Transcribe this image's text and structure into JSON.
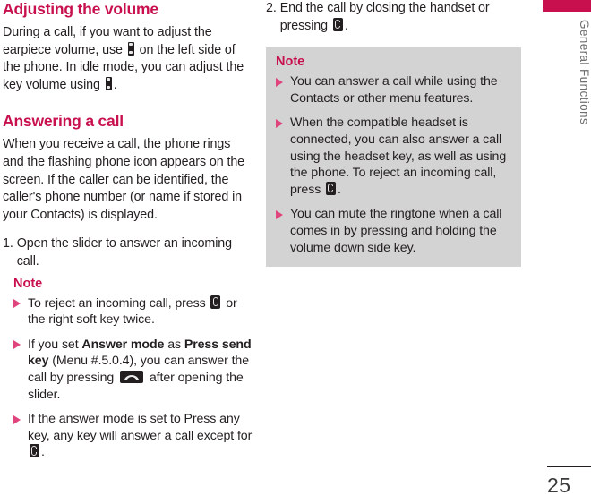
{
  "sidebar": {
    "chapter_label": "General Functions",
    "page_number": "25",
    "accent_color": "#c8104e"
  },
  "left_column": {
    "section1": {
      "heading": "Adjusting the volume",
      "paragraph_a": "During a call, if you want to adjust the earpiece volume, use ",
      "paragraph_b": " on the left side of the phone. In idle mode, you can adjust the key volume using ",
      "paragraph_c": "."
    },
    "section2": {
      "heading": "Answering a call",
      "paragraph": "When you receive a call, the phone rings and the flashing phone icon appears on the screen. If the caller can be identified, the caller's phone number (or name if stored in your Contacts) is displayed."
    },
    "step1": {
      "number": "1.",
      "text": "Open the slider to answer an incoming call."
    },
    "note": {
      "title": "Note",
      "items": [
        {
          "parts": [
            {
              "type": "text",
              "value": "To reject an incoming call, press "
            },
            {
              "type": "icon",
              "value": "end-call-key-icon"
            },
            {
              "type": "text",
              "value": " or the right soft key twice."
            }
          ]
        },
        {
          "parts": [
            {
              "type": "text",
              "value": "If you set "
            },
            {
              "type": "bold",
              "value": "Answer mode"
            },
            {
              "type": "text",
              "value": " as "
            },
            {
              "type": "bold",
              "value": "Press send key"
            },
            {
              "type": "text",
              "value": " (Menu #.5.0.4), you can answer the call by pressing "
            },
            {
              "type": "icon",
              "value": "send-key-icon"
            },
            {
              "type": "text",
              "value": " after opening the slider."
            }
          ]
        },
        {
          "parts": [
            {
              "type": "text",
              "value": "If the answer mode is set to Press any key, any key will answer a call except for "
            },
            {
              "type": "icon",
              "value": "end-call-key-icon"
            },
            {
              "type": "text",
              "value": "."
            }
          ]
        }
      ]
    }
  },
  "right_column": {
    "step2": {
      "number": "2.",
      "text_a": "End the call by closing the handset or pressing ",
      "text_b": "."
    },
    "note": {
      "title": "Note",
      "background_color": "#d3d3d3",
      "items": [
        {
          "parts": [
            {
              "type": "text",
              "value": "You can answer a call while using the Contacts or other menu features."
            }
          ]
        },
        {
          "parts": [
            {
              "type": "text",
              "value": "When the compatible headset is connected, you can also answer a call using the headset key, as well as using the phone. To reject an incoming call, press "
            },
            {
              "type": "icon",
              "value": "end-call-key-icon"
            },
            {
              "type": "text",
              "value": "."
            }
          ]
        },
        {
          "parts": [
            {
              "type": "text",
              "value": "You can mute the ringtone when a call comes in by pressing and holding the volume down side key."
            }
          ]
        }
      ]
    }
  }
}
